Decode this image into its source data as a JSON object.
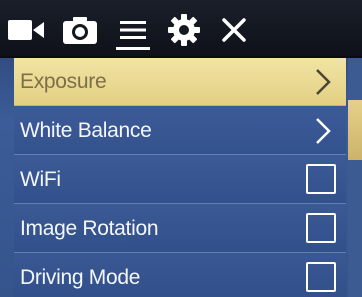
{
  "tabs": [
    {
      "icon": "video-camera-icon"
    },
    {
      "icon": "photo-camera-icon"
    },
    {
      "icon": "menu-icon",
      "active": true
    },
    {
      "icon": "gear-icon"
    },
    {
      "icon": "close-icon"
    }
  ],
  "menu": {
    "items": [
      {
        "label": "Exposure",
        "control": "submenu",
        "selected": true
      },
      {
        "label": "White Balance",
        "control": "submenu"
      },
      {
        "label": "WiFi",
        "control": "checkbox",
        "checked": false
      },
      {
        "label": "Image Rotation",
        "control": "checkbox",
        "checked": false
      },
      {
        "label": "Driving Mode",
        "control": "checkbox",
        "checked": false
      }
    ]
  },
  "colors": {
    "selected_bg": "#e9d893",
    "selected_text": "#7d6f4a",
    "item_text": "#f4f6fb",
    "tabbar_bg": "#141821"
  }
}
